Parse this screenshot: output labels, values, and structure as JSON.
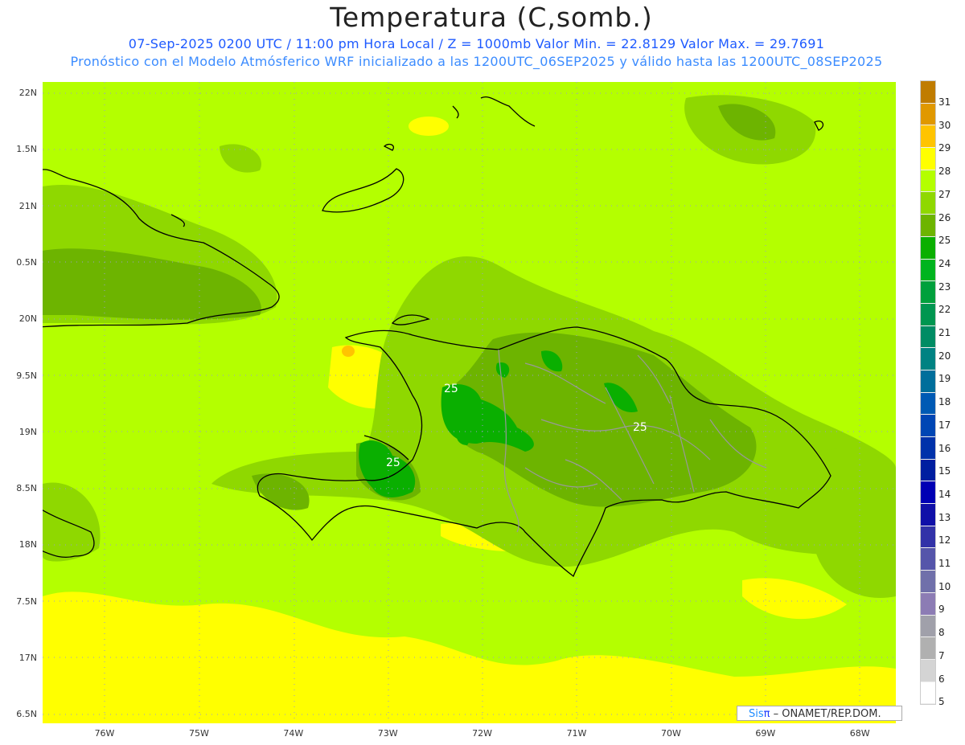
{
  "header": {
    "title": "Temperatura (C,somb.)",
    "line1": "07-Sep-2025 0200 UTC / 11:00 pm Hora Local / Z = 1000mb  Valor Min. = 22.8129  Valor Max. = 29.7691",
    "line2": "Pronóstico con el Modelo Atmósferico WRF inicializado a las 1200UTC_06SEP2025 y válido hasta las  1200UTC_08SEP2025"
  },
  "lat_labels": [
    "22N",
    "1.5N",
    "21N",
    "0.5N",
    "20N",
    "9.5N",
    "19N",
    "8.5N",
    "18N",
    "7.5N",
    "17N",
    "6.5N"
  ],
  "lon_labels": [
    "76W",
    "75W",
    "74W",
    "73W",
    "72W",
    "71W",
    "70W",
    "69W",
    "68W"
  ],
  "colorbar": {
    "labels": [
      "31",
      "30",
      "29",
      "28",
      "27",
      "26",
      "25",
      "24",
      "23",
      "22",
      "21",
      "20",
      "19",
      "18",
      "17",
      "16",
      "15",
      "14",
      "13",
      "12",
      "11",
      "10",
      "9",
      "8",
      "7",
      "6",
      "5"
    ],
    "colors": [
      "#c07c00",
      "#e09800",
      "#ffc400",
      "#ffff00",
      "#b4ff00",
      "#8fd800",
      "#6db400",
      "#0aaf00",
      "#00b41e",
      "#00a03c",
      "#009650",
      "#008c64",
      "#008282",
      "#006e9b",
      "#005ab4",
      "#0046b4",
      "#0032aa",
      "#001ea0",
      "#0000b4",
      "#1010a8",
      "#3232a8",
      "#5555aa",
      "#7070aa",
      "#8c7cb4",
      "#a0a0aa",
      "#b0b0b0",
      "#d4d4d4",
      "#ffffff"
    ]
  },
  "contour_labels": [
    "25",
    "25",
    "25"
  ],
  "credit": {
    "sis": "Sis",
    "pi": "π",
    "rest": "– ONAMET/REP.DOM."
  }
}
